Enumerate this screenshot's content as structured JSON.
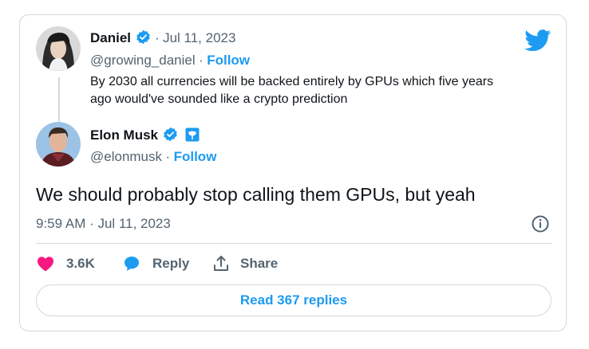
{
  "quoted_tweet": {
    "author_name": "Daniel",
    "separator": "·",
    "date": "Jul 11, 2023",
    "handle": "@growing_daniel",
    "handle_separator": "·",
    "follow_label": "Follow",
    "text_line1": "By 2030 all currencies will be backed entirely by GPUs which five years",
    "text_line2": "ago would've sounded like a crypto prediction"
  },
  "main_tweet": {
    "author_name": "Elon Musk",
    "handle": "@elonmusk",
    "handle_separator": "·",
    "follow_label": "Follow",
    "text": "We should probably stop calling them GPUs, but yeah",
    "timestamp": "9:59 AM · Jul 11, 2023"
  },
  "actions": {
    "like_count": "3.6K",
    "reply_label": "Reply",
    "share_label": "Share"
  },
  "read_replies_label": "Read 367 replies",
  "colors": {
    "accent": "#1d9bf0",
    "like": "#f91880",
    "muted": "#536471",
    "border": "#cfd9de",
    "badge_gold": "#1d9bf0"
  },
  "icons": [
    "twitter-bird-icon",
    "verified-badge-icon",
    "affiliate-badge-icon",
    "info-icon",
    "heart-icon",
    "reply-bubble-icon",
    "share-icon"
  ]
}
